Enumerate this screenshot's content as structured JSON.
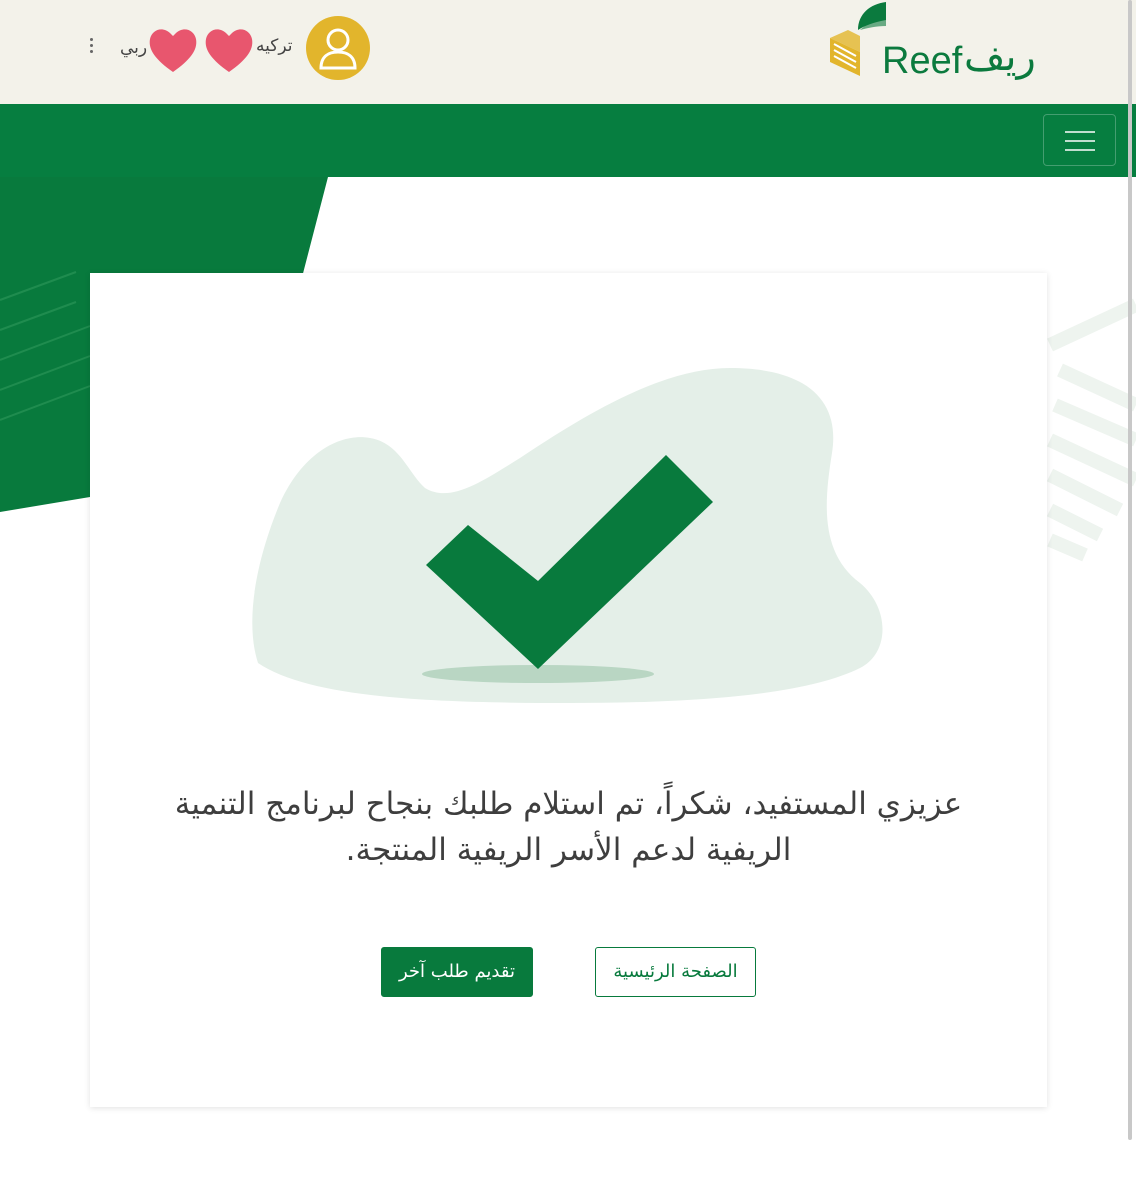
{
  "header": {
    "logo_ar": "ريف",
    "logo_en": "Reef",
    "user_name": "تركيه",
    "language_label": "ربي",
    "avatar_icon": "user-icon",
    "menu_icon": "kebab-menu-icon"
  },
  "navbar": {
    "toggle_icon": "hamburger-icon"
  },
  "colors": {
    "brand_green": "#067e40",
    "header_bg": "#f3f2ea",
    "avatar_yellow": "#e2b52c",
    "blob_bg": "#e4efe8"
  },
  "confirmation": {
    "icon": "checkmark-icon",
    "message": "عزيزي المستفيد، شكراً، تم استلام طلبك بنجاح لبرنامج التنمية الريفية لدعم الأسر الريفية المنتجة."
  },
  "actions": {
    "new_request_label": "تقديم طلب آخر",
    "home_label": "الصفحة الرئيسية"
  }
}
